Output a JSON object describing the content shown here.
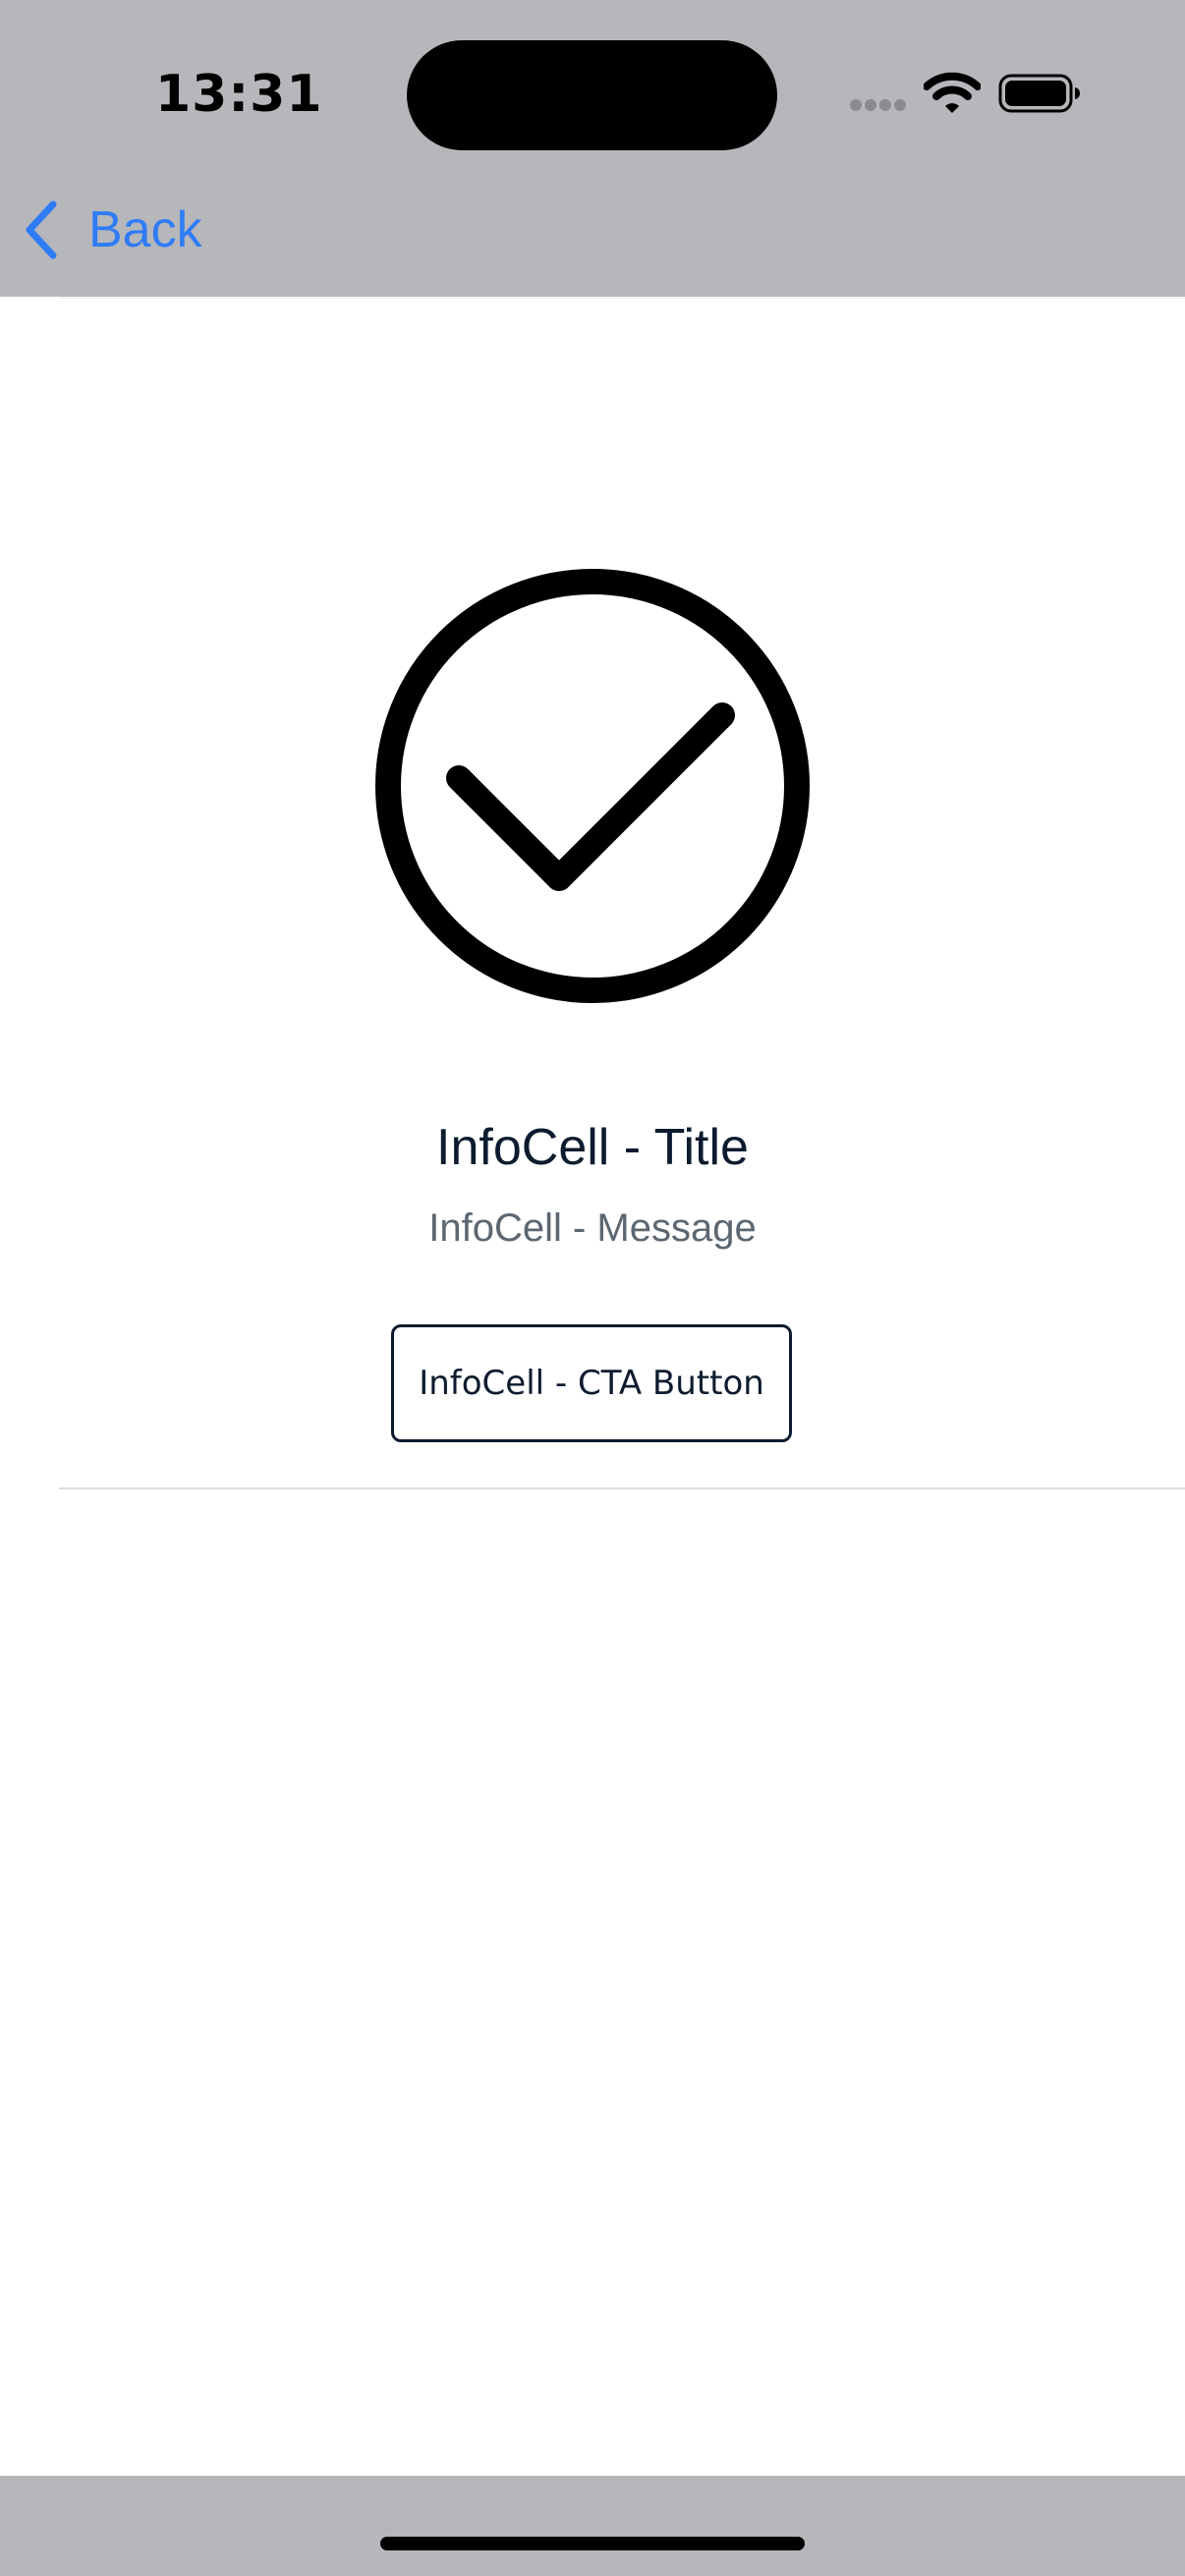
{
  "status_bar": {
    "time": "13:31",
    "icons": [
      "cellular-dots-icon",
      "wifi-icon",
      "battery-icon"
    ]
  },
  "nav": {
    "back_label": "Back",
    "back_icon": "chevron-left-icon"
  },
  "info_cell": {
    "icon": "check-circle-icon",
    "title": "InfoCell - Title",
    "message": "InfoCell - Message",
    "cta_label": "InfoCell - CTA Button"
  },
  "colors": {
    "accent": "#2f7cf6",
    "bars_background": "#b6b7bb",
    "title_text": "#0d1b2e",
    "message_text": "#5c6771"
  }
}
